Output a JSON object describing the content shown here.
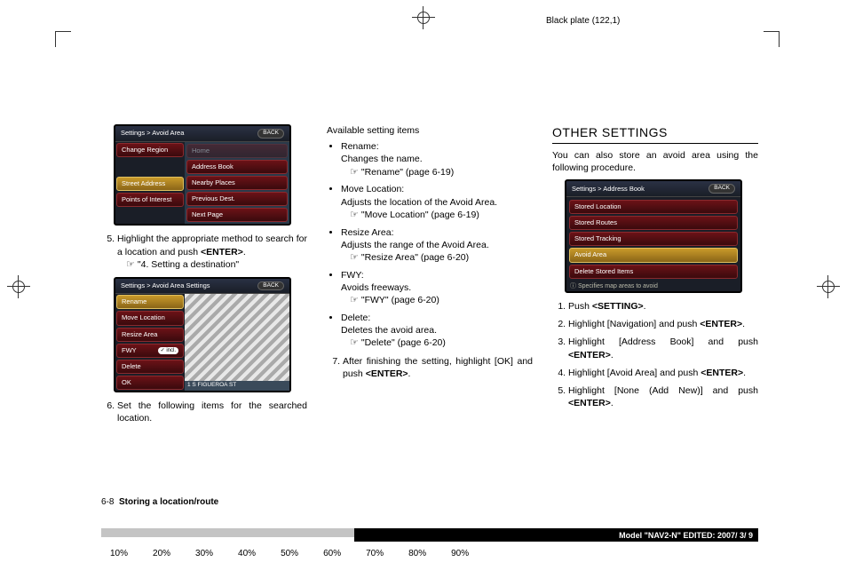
{
  "plate": "Black plate (122,1)",
  "col1": {
    "screenshot1": {
      "breadcrumb": "Settings > Avoid Area",
      "back": "BACK",
      "left_menu": [
        "Change Region",
        "Street Address",
        "Points of Interest"
      ],
      "right_menu": [
        "Home",
        "Address Book",
        "Nearby Places",
        "Previous Dest.",
        "Next Page"
      ]
    },
    "step5": "Highlight the appropriate method to search for a location and push ",
    "step5_btn": "<ENTER>",
    "step5_dot": ".",
    "ref5": "\"4. Setting a destination\"",
    "screenshot2": {
      "breadcrumb": "Settings > Avoid Area Settings",
      "back": "BACK",
      "menu": [
        "Rename",
        "Move Location",
        "Resize Area",
        "FWY",
        "Delete",
        "OK"
      ],
      "fwy_tag": "incl.",
      "map_footer": "1 S FIGUEROA ST"
    },
    "step6": "Set the following items for the searched location."
  },
  "col2": {
    "heading": "Available setting items",
    "items": [
      {
        "title": "Rename:",
        "desc": "Changes the name.",
        "ref": "\"Rename\" (page 6-19)"
      },
      {
        "title": "Move Location:",
        "desc": "Adjusts the location of the Avoid Area.",
        "ref": "\"Move Location\" (page 6-19)"
      },
      {
        "title": "Resize Area:",
        "desc": "Adjusts the range of the Avoid Area.",
        "ref": "\"Resize Area\" (page 6-20)"
      },
      {
        "title": "FWY:",
        "desc": "Avoids freeways.",
        "ref": "\"FWY\" (page 6-20)"
      },
      {
        "title": "Delete:",
        "desc": "Deletes the avoid area.",
        "ref": "\"Delete\" (page 6-20)"
      }
    ],
    "step7": "After finishing the setting, highlight [OK] and push ",
    "step7_btn": "<ENTER>",
    "step7_dot": "."
  },
  "col3": {
    "title": "OTHER SETTINGS",
    "intro": "You can also store an avoid area using the following procedure.",
    "screenshot3": {
      "breadcrumb": "Settings > Address Book",
      "back": "BACK",
      "menu": [
        "Stored Location",
        "Stored Routes",
        "Stored Tracking",
        "Avoid Area",
        "Delete Stored Items"
      ],
      "note": "Specifies map areas to avoid"
    },
    "steps": [
      {
        "t": "Push ",
        "b": "<SETTING>",
        "a": "."
      },
      {
        "t": "Highlight [Navigation] and push ",
        "b": "<ENTER>",
        "a": "."
      },
      {
        "t": "Highlight [Address Book] and push ",
        "b": "<ENTER>",
        "a": "."
      },
      {
        "t": "Highlight [Avoid Area] and push ",
        "b": "<ENTER>",
        "a": "."
      },
      {
        "t": "Highlight [None (Add New)] and push ",
        "b": "<ENTER>",
        "a": "."
      }
    ]
  },
  "footer": {
    "page_num": "6-8",
    "page_title": "Storing a location/route",
    "model_line": "Model \"NAV2-N\" EDITED: 2007/ 3/ 9",
    "percents": [
      "10%",
      "20%",
      "30%",
      "40%",
      "50%",
      "60%",
      "70%",
      "80%",
      "90%"
    ]
  }
}
